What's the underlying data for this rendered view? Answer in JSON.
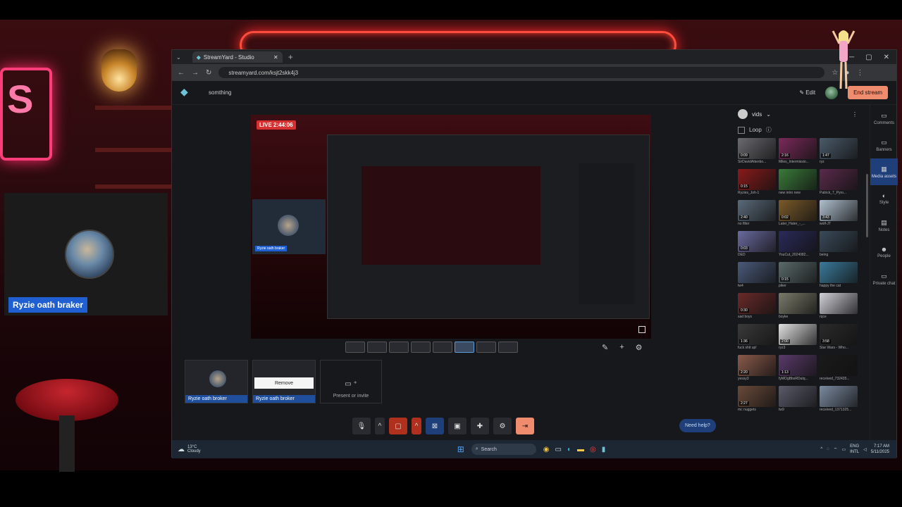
{
  "webcam": {
    "name": "Ryzie oath braker"
  },
  "browser": {
    "tab_title": "StreamYard - Studio",
    "url": "streamyard.com/ksjt2skk4j3"
  },
  "studio": {
    "name": "somthing",
    "edit_label": "Edit",
    "end_stream_label": "End stream",
    "live_badge": "LIVE 2:44:06"
  },
  "backstage": {
    "tile1_name": "Ryzie oath broker",
    "tile2_name": "Ryzie oath broker",
    "remove_label": "Remove",
    "present_label": "Present or invite"
  },
  "help_label": "Need help?",
  "media_panel": {
    "title": "vids",
    "loop_label": "Loop",
    "items": [
      {
        "dur": "0:09",
        "title": "SirDavidAttenbo...",
        "color": "#6a6a70"
      },
      {
        "dur": "2:16",
        "title": "Miles_Intermissio...",
        "color": "#7a2a5a"
      },
      {
        "dur": "1:47",
        "title": "ryz",
        "color": "#4a5a6a"
      },
      {
        "dur": "0:15",
        "title": "Ryzies_Joh-1",
        "color": "#8a1a1a"
      },
      {
        "dur": "",
        "title": "new intro new",
        "color": "#3a7a3a"
      },
      {
        "dur": "",
        "title": "Patrick_7_Pyro...",
        "color": "#5a2a4a"
      },
      {
        "dur": "2:40",
        "title": "no filter",
        "color": "#5a6a7a"
      },
      {
        "dur": "0:02",
        "title": "Later_Hater_-_...",
        "color": "#7a5a2a"
      },
      {
        "dur": "3:43",
        "title": "wolf-JT",
        "color": "#b0c0d0"
      },
      {
        "dur": "0:03",
        "title": "DED",
        "color": "#6a6aa0"
      },
      {
        "dur": "",
        "title": "YouCut_2024082...",
        "color": "#2a2a5a"
      },
      {
        "dur": "",
        "title": "being",
        "color": "#3a4a5a"
      },
      {
        "dur": "",
        "title": "tw4",
        "color": "#4a5a7a"
      },
      {
        "dur": "0:15",
        "title": "piker",
        "color": "#5a6a6a"
      },
      {
        "dur": "",
        "title": "happy the cat",
        "color": "#3a7a9a"
      },
      {
        "dur": "0:30",
        "title": "sad boys",
        "color": "#6a2a2a"
      },
      {
        "dur": "",
        "title": "boyke",
        "color": "#7a7a6a"
      },
      {
        "dur": "",
        "title": "rqce",
        "color": "#d0d0d8"
      },
      {
        "dur": "1:36",
        "title": "fuck shit up!",
        "color": "#3a3a3a"
      },
      {
        "dur": "2:00",
        "title": "ryz3",
        "color": "#e0e0e0"
      },
      {
        "dur": "3:58",
        "title": "Star Wars - Who...",
        "color": "#2a2a2a"
      },
      {
        "dur": "2:20",
        "title": "yessy3",
        "color": "#8a5a4a"
      },
      {
        "dur": "1:13",
        "title": "fyMOgBbsRDutq...",
        "color": "#5a3a6a"
      },
      {
        "dur": "",
        "title": "received_732435...",
        "color": "#1a1a1a"
      },
      {
        "dur": "2:27",
        "title": "mc nuggets",
        "color": "#6a4a3a"
      },
      {
        "dur": "",
        "title": "tw9",
        "color": "#5a5a6a"
      },
      {
        "dur": "",
        "title": "received_1371325...",
        "color": "#7a8aa0"
      }
    ]
  },
  "rail": [
    {
      "label": "Comments",
      "icon": "▭"
    },
    {
      "label": "Banners",
      "icon": "▭"
    },
    {
      "label": "Media assets",
      "icon": "▦"
    },
    {
      "label": "Style",
      "icon": "◐"
    },
    {
      "label": "Notes",
      "icon": "▤"
    },
    {
      "label": "People",
      "icon": "☻"
    },
    {
      "label": "Private chat",
      "icon": "▭"
    }
  ],
  "taskbar": {
    "weather_temp": "13°C",
    "weather_desc": "Cloudy",
    "search_label": "Search",
    "lang1": "ENG",
    "lang2": "INTL",
    "time": "7:17 AM",
    "date": "5/11/2025"
  }
}
